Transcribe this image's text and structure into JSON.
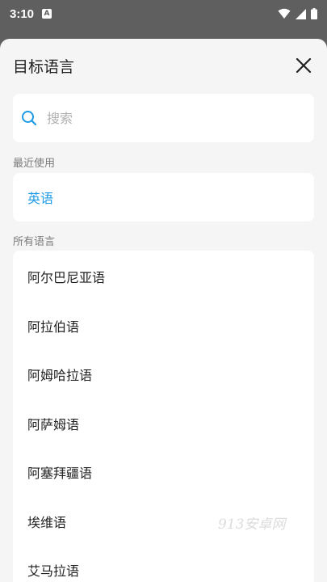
{
  "status_bar": {
    "time": "3:10",
    "notification_badge": "A"
  },
  "sheet": {
    "title": "目标语言",
    "search": {
      "placeholder": "搜索",
      "value": ""
    },
    "recent_label": "最近使用",
    "recent_items": [
      "英语"
    ],
    "all_label": "所有语言",
    "all_items": [
      "阿尔巴尼亚语",
      "阿拉伯语",
      "阿姆哈拉语",
      "阿萨姆语",
      "阿塞拜疆语",
      "埃维语",
      "艾马拉语"
    ]
  },
  "watermark": "913安卓网",
  "colors": {
    "accent": "#1e9be6",
    "sheet_bg": "#f5f5f5",
    "overlay": "#5f5f5f"
  },
  "icons": {
    "close": "close-icon",
    "search": "search-icon"
  }
}
